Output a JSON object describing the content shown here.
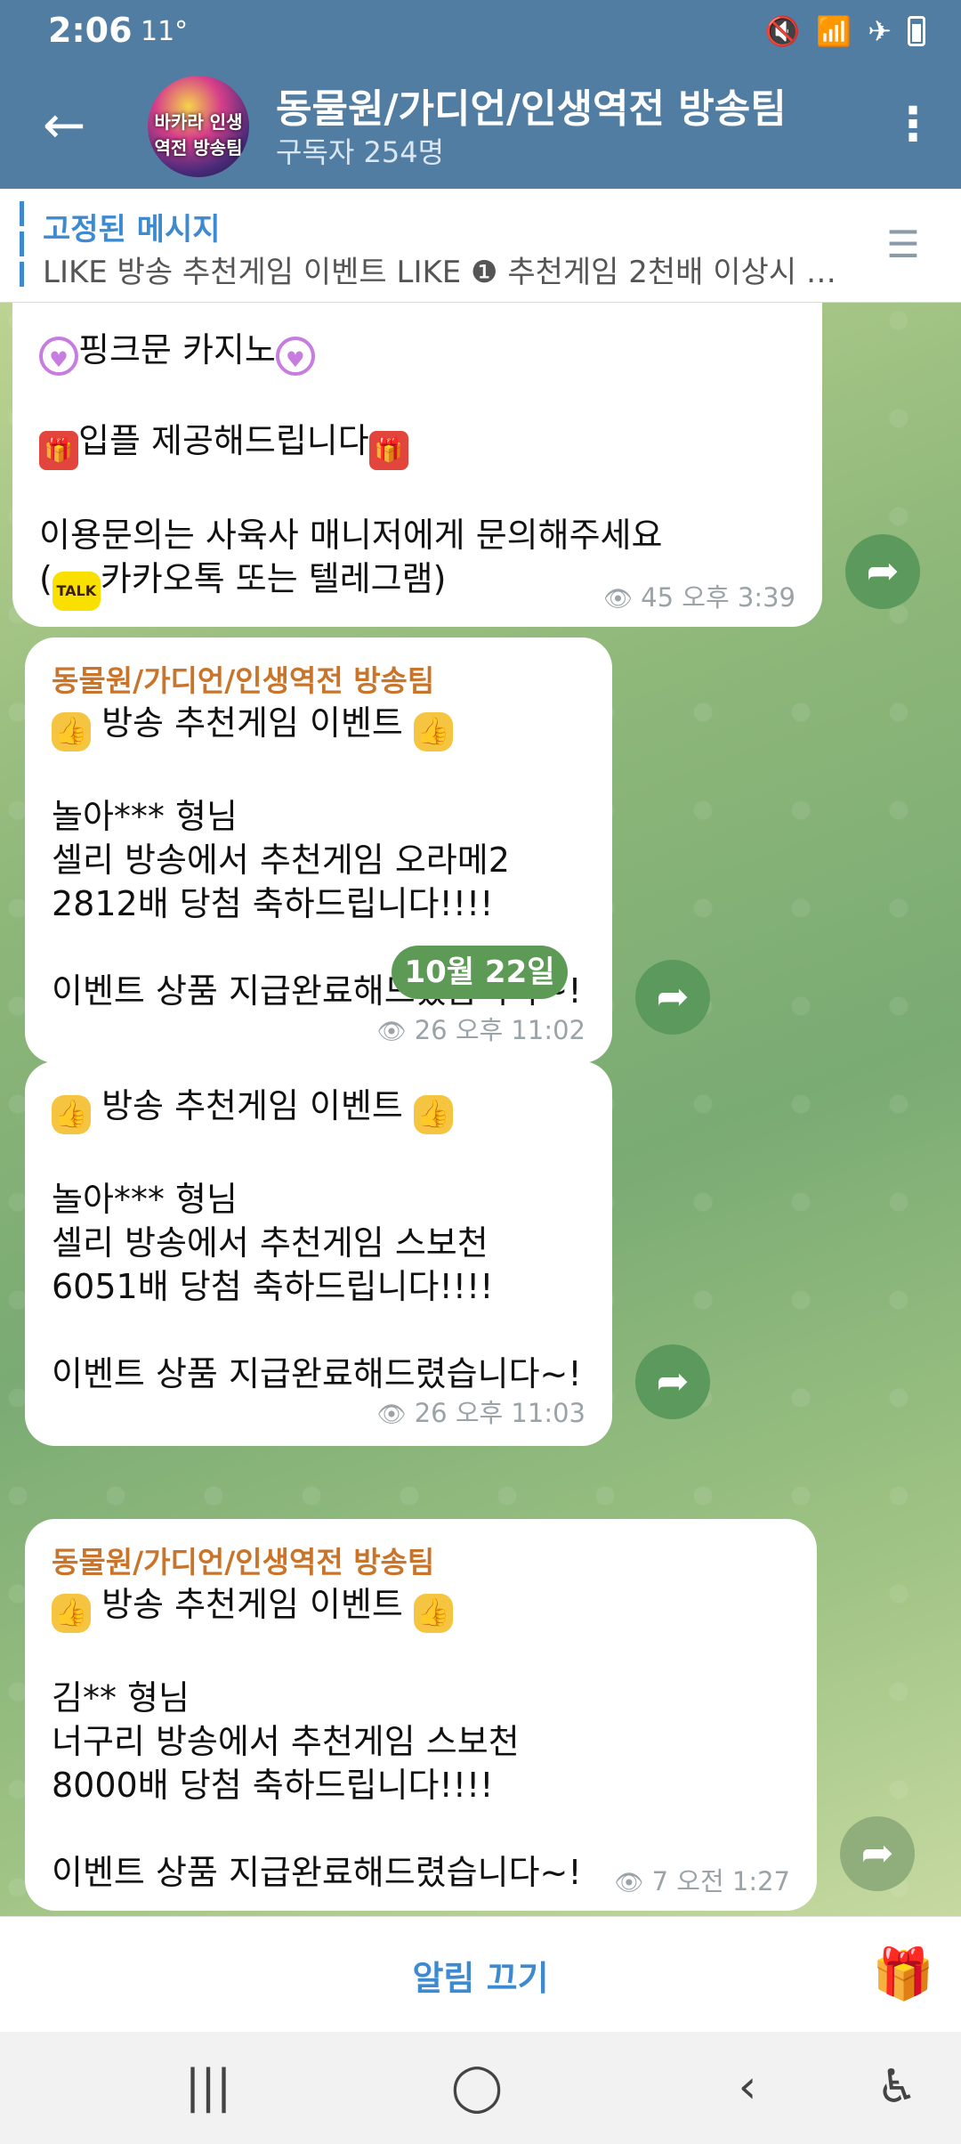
{
  "status": {
    "time": "2:06",
    "temp": "11°"
  },
  "header": {
    "title": "동물원/가디언/인생역전 방송팀",
    "subtitle": "구독자 254명",
    "avatar_text": "바카라 인생역전 방송팀"
  },
  "pinned": {
    "title": "고정된 메시지",
    "text": "LIKE 방송 추천게임 이벤트 LIKE   ❶ 추천게임 2천배 이상시 🎯…"
  },
  "messages": [
    {
      "lines": [
        "",
        "핑크문 카지노",
        "",
        "입플 제공해드립니다",
        "",
        "이용문의는 사육사 매니저에게 문의해주세요",
        "카카오톡 또는 텔레그램)"
      ],
      "views": "45",
      "time": "오후 3:39"
    },
    {
      "sender": "동물원/가디언/인생역전 방송팀",
      "lines": [
        "방송 추천게임 이벤트",
        "",
        "놀아*** 형님",
        "셀리 방송에서 추천게임 오라메2",
        "2812배 당첨 축하드립니다!!!!",
        "",
        "이벤트 상품 지급완료해드렸습니다~!"
      ],
      "views": "26",
      "time": "오후 11:02"
    },
    {
      "lines": [
        "방송 추천게임 이벤트",
        "",
        "놀아*** 형님",
        "셀리 방송에서 추천게임 스보천",
        "6051배 당첨 축하드립니다!!!!",
        "",
        "이벤트 상품 지급완료해드렸습니다~!"
      ],
      "views": "26",
      "time": "오후 11:03"
    },
    {
      "sender": "동물원/가디언/인생역전 방송팀",
      "lines": [
        "방송 추천게임 이벤트",
        "",
        "김** 형님",
        "너구리 방송에서 추천게임 스보천",
        "8000배 당첨 축하드립니다!!!!",
        "",
        "이벤트 상품 지급완료해드렸습니다~!"
      ],
      "views": "7",
      "time": "오전 1:27"
    }
  ],
  "date_divider": "10월 22일",
  "bottom": {
    "mute_label": "알림 끄기"
  },
  "icons": {
    "back": "back-arrow-icon",
    "menu": "more-vertical-icon",
    "forward": "share-forward-icon",
    "gift": "gift-icon",
    "view": "eye-icon"
  }
}
